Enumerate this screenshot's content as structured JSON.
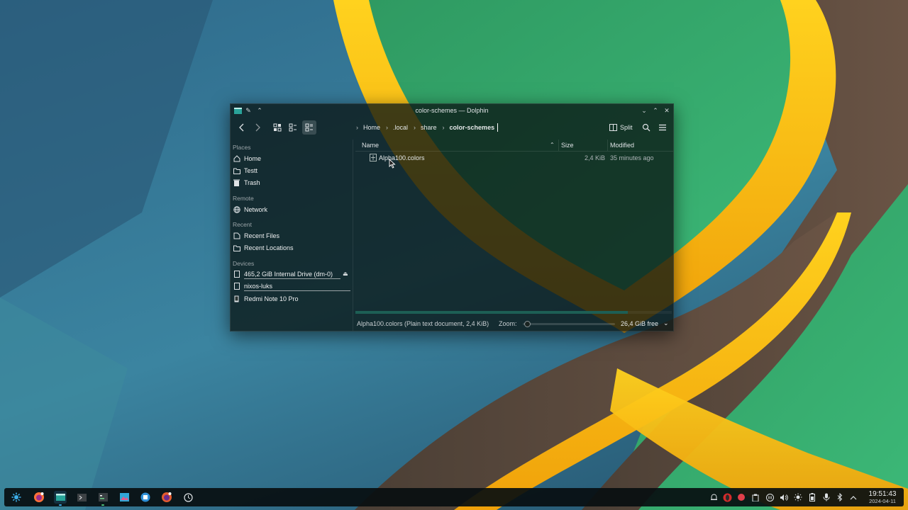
{
  "window": {
    "title": "color-schemes — Dolphin"
  },
  "toolbar": {
    "breadcrumb": [
      "Home",
      ".local",
      "share",
      "color-schemes"
    ],
    "split_label": "Split"
  },
  "sidebar": {
    "sections": {
      "places": "Places",
      "remote": "Remote",
      "recent": "Recent",
      "devices": "Devices"
    },
    "places": [
      {
        "label": "Home",
        "icon": "home-icon"
      },
      {
        "label": "Testt",
        "icon": "folder-icon"
      },
      {
        "label": "Trash",
        "icon": "trash-icon"
      }
    ],
    "remote": [
      {
        "label": "Network",
        "icon": "network-icon"
      }
    ],
    "recent": [
      {
        "label": "Recent Files",
        "icon": "recent-files-icon"
      },
      {
        "label": "Recent Locations",
        "icon": "recent-locations-icon"
      }
    ],
    "devices": [
      {
        "label": "465,2 GiB Internal Drive (dm-0)",
        "icon": "drive-icon"
      },
      {
        "label": "nixos-luks",
        "icon": "drive-icon"
      },
      {
        "label": "Redmi Note 10 Pro",
        "icon": "phone-icon"
      }
    ]
  },
  "file_view": {
    "columns": {
      "name": "Name",
      "size": "Size",
      "modified": "Modified"
    },
    "files": [
      {
        "name": "Alpha100.colors",
        "size": "2,4 KiB",
        "modified": "35 minutes ago"
      }
    ]
  },
  "statusbar": {
    "selection_text": "Alpha100.colors (Plain text document, 2,4 KiB)",
    "zoom_label": "Zoom:",
    "zoom_level": 0.02,
    "free_space": "26,4 GiB free",
    "disk_used_fraction": 0.86
  },
  "taskbar": {
    "apps": [
      "app-launcher-icon",
      "firefox-icon",
      "dolphin-icon",
      "terminal-icon",
      "system-monitor-icon",
      "image-viewer-icon",
      "discover-icon",
      "firefox-private-icon",
      "clock-app-icon"
    ],
    "tray": [
      "notifications-icon",
      "opera-icon",
      "record-icon",
      "pause-icon",
      "clipboard-icon",
      "volume-icon",
      "brightness-icon",
      "battery-icon",
      "microphone-icon",
      "bluetooth-icon",
      "network-tray-icon",
      "tray-expand-icon"
    ],
    "time": "19:51:43",
    "date": "2024-04-11"
  },
  "colors": {
    "accent": "#3daee9",
    "yellow": "#f5b812",
    "green": "#3fa86a"
  }
}
